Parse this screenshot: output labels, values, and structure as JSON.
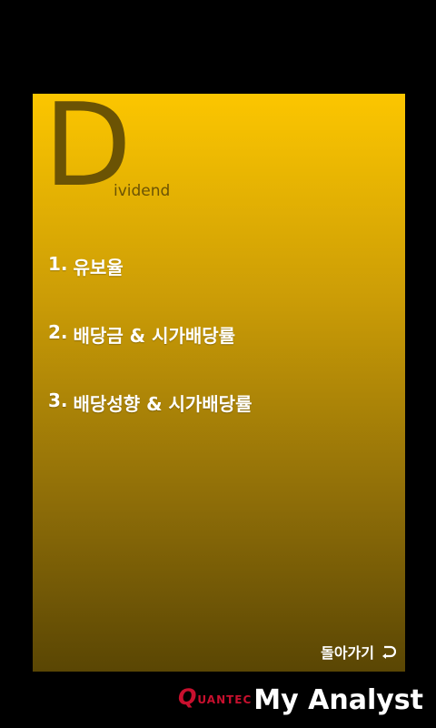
{
  "header": {
    "big_letter": "D",
    "rest_of_title": "ividend"
  },
  "menu": {
    "items": [
      {
        "number": "1.",
        "label": "유보율"
      },
      {
        "number": "2.",
        "label": "배당금 & 시가배당률"
      },
      {
        "number": "3.",
        "label": "배당성향 & 시가배당률"
      }
    ]
  },
  "back_button": {
    "label": "돌아가기",
    "icon": "return-arrow-icon"
  },
  "footer": {
    "brand_first_letter": "Q",
    "brand_rest": "UANTEC",
    "app_name": "My Analyst"
  },
  "colors": {
    "panel_top": "#fcc600",
    "panel_bottom": "#5a4604",
    "title_color": "#6b5304",
    "brand_red": "#c8102e"
  }
}
